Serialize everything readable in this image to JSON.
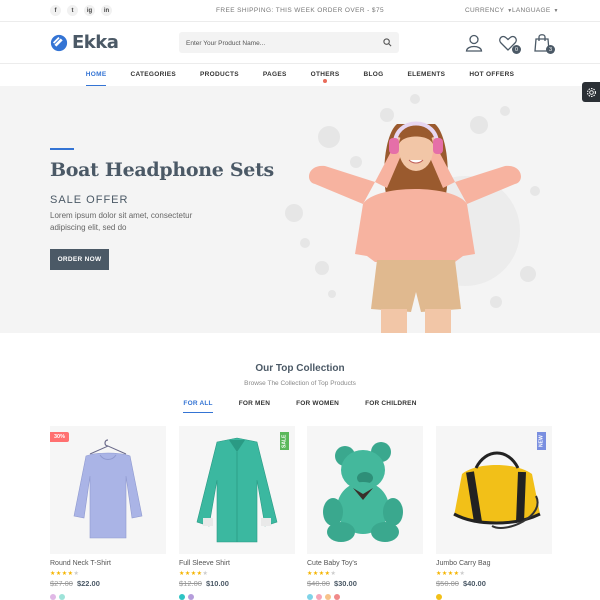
{
  "topbar": {
    "socials": [
      "f",
      "t",
      "ig",
      "in"
    ],
    "shipping": "FREE SHIPPING: THIS WEEK ORDER OVER - $75",
    "currency": "CURRENCY",
    "language": "LANGUAGE"
  },
  "header": {
    "logo": "Ekka",
    "search_placeholder": "Enter Your Product Name...",
    "wishlist_count": "0",
    "cart_count": "3"
  },
  "nav": [
    "HOME",
    "CATEGORIES",
    "PRODUCTS",
    "PAGES",
    "OTHERS",
    "BLOG",
    "ELEMENTS",
    "HOT OFFERS"
  ],
  "hero": {
    "title": "Boat Headphone Sets",
    "offer": "SALE OFFER",
    "description": "Lorem ipsum dolor sit amet, consectetur adipiscing elit, sed do",
    "button": "ORDER NOW"
  },
  "collection": {
    "title": "Our Top Collection",
    "subtitle": "Browse The Collection of Top Products",
    "tabs": [
      "FOR ALL",
      "FOR MEN",
      "FOR WOMEN",
      "FOR CHILDREN"
    ]
  },
  "products": [
    {
      "name": "Round Neck T-Shirt",
      "old_price": "$27.00",
      "price": "$22.00",
      "badge": "30%",
      "rating": 4
    },
    {
      "name": "Full Sleeve Shirt",
      "old_price": "$12.00",
      "price": "$10.00",
      "badge": "SALE",
      "rating": 4
    },
    {
      "name": "Cute Baby Toy's",
      "old_price": "$40.00",
      "price": "$30.00",
      "badge": "",
      "rating": 4
    },
    {
      "name": "Jumbo Carry Bag",
      "old_price": "$50.00",
      "price": "$40.00",
      "badge": "NEW",
      "rating": 4
    }
  ],
  "colors": {
    "accent": "#3474d4",
    "text": "#4b5966",
    "star": "#f5b400"
  }
}
